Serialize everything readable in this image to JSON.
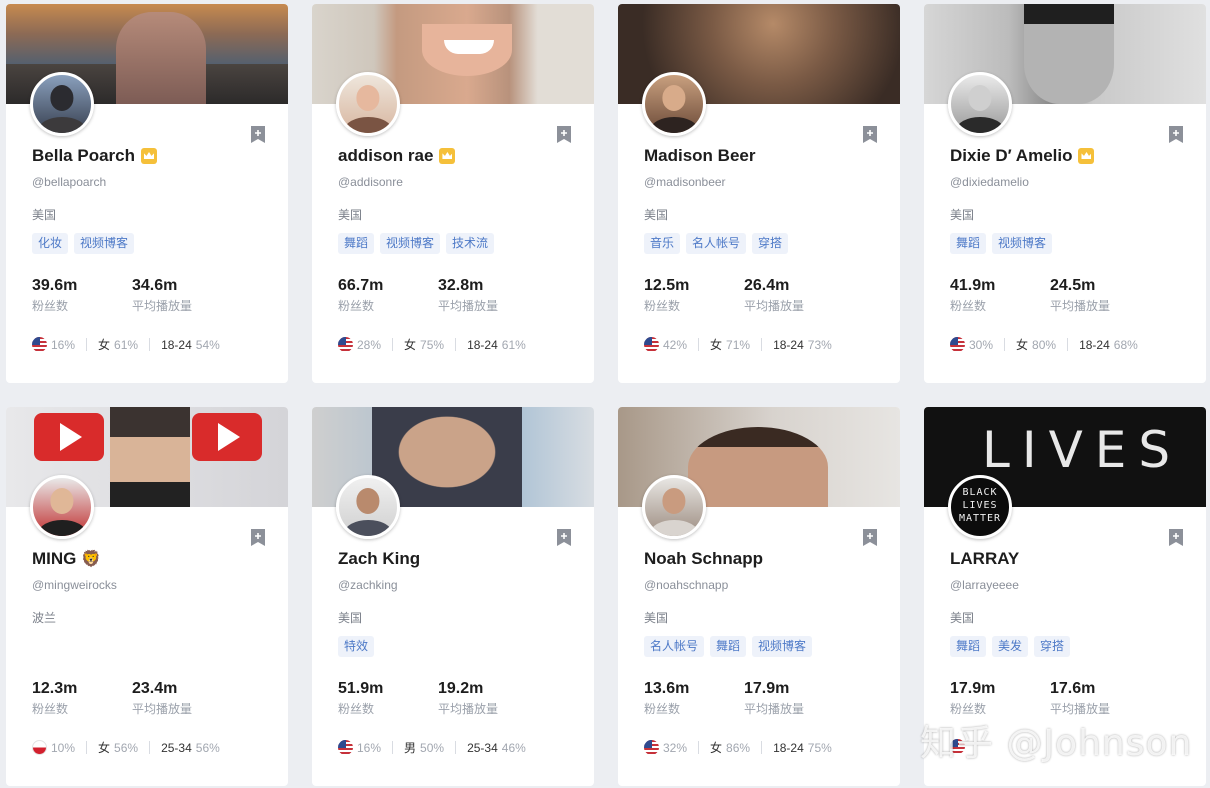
{
  "cards": [
    {
      "name": "Bella Poarch",
      "badge": "crown",
      "handle": "@bellapoarch",
      "country": "美国",
      "tags": [
        "化妆",
        "视频博客"
      ],
      "followers": "39.6m",
      "followers_label": "粉丝数",
      "avg_views": "34.6m",
      "avg_views_label": "平均播放量",
      "flag": "us-flag-icon",
      "country_pct": "16%",
      "gender": "女",
      "gender_pct": "61%",
      "age": "18-24",
      "age_pct": "54%"
    },
    {
      "name": "addison rae",
      "badge": "crown",
      "handle": "@addisonre",
      "country": "美国",
      "tags": [
        "舞蹈",
        "视频博客",
        "技术流"
      ],
      "followers": "66.7m",
      "followers_label": "粉丝数",
      "avg_views": "32.8m",
      "avg_views_label": "平均播放量",
      "flag": "us-flag-icon",
      "country_pct": "28%",
      "gender": "女",
      "gender_pct": "75%",
      "age": "18-24",
      "age_pct": "61%"
    },
    {
      "name": "Madison Beer",
      "badge": "",
      "handle": "@madisonbeer",
      "country": "美国",
      "tags": [
        "音乐",
        "名人帐号",
        "穿搭"
      ],
      "followers": "12.5m",
      "followers_label": "粉丝数",
      "avg_views": "26.4m",
      "avg_views_label": "平均播放量",
      "flag": "us-flag-icon",
      "country_pct": "42%",
      "gender": "女",
      "gender_pct": "71%",
      "age": "18-24",
      "age_pct": "73%"
    },
    {
      "name": "Dixie D′ Amelio",
      "badge": "crown",
      "handle": "@dixiedamelio",
      "country": "美国",
      "tags": [
        "舞蹈",
        "视频博客"
      ],
      "followers": "41.9m",
      "followers_label": "粉丝数",
      "avg_views": "24.5m",
      "avg_views_label": "平均播放量",
      "flag": "us-flag-icon",
      "country_pct": "30%",
      "gender": "女",
      "gender_pct": "80%",
      "age": "18-24",
      "age_pct": "68%"
    },
    {
      "name": "MING",
      "badge": "emoji",
      "emoji": "🦁",
      "handle": "@mingweirocks",
      "country": "波兰",
      "tags": [],
      "followers": "12.3m",
      "followers_label": "粉丝数",
      "avg_views": "23.4m",
      "avg_views_label": "平均播放量",
      "flag": "poland-flag-icon",
      "country_pct": "10%",
      "gender": "女",
      "gender_pct": "56%",
      "age": "25-34",
      "age_pct": "56%"
    },
    {
      "name": "Zach King",
      "badge": "",
      "handle": "@zachking",
      "country": "美国",
      "tags": [
        "特效"
      ],
      "followers": "51.9m",
      "followers_label": "粉丝数",
      "avg_views": "19.2m",
      "avg_views_label": "平均播放量",
      "flag": "us-flag-icon",
      "country_pct": "16%",
      "gender": "男",
      "gender_pct": "50%",
      "age": "25-34",
      "age_pct": "46%"
    },
    {
      "name": "Noah Schnapp",
      "badge": "",
      "handle": "@noahschnapp",
      "country": "美国",
      "tags": [
        "名人帐号",
        "舞蹈",
        "视频博客"
      ],
      "followers": "13.6m",
      "followers_label": "粉丝数",
      "avg_views": "17.9m",
      "avg_views_label": "平均播放量",
      "flag": "us-flag-icon",
      "country_pct": "32%",
      "gender": "女",
      "gender_pct": "86%",
      "age": "18-24",
      "age_pct": "75%"
    },
    {
      "name": "LARRAY",
      "badge": "",
      "handle": "@larrayeeee",
      "country": "美国",
      "tags": [
        "舞蹈",
        "美发",
        "穿搭"
      ],
      "followers": "17.9m",
      "followers_label": "粉丝数",
      "avg_views": "17.6m",
      "avg_views_label": "平均播放量",
      "flag": "us-flag-icon",
      "country_pct": "",
      "gender": "",
      "gender_pct": "",
      "age": "",
      "age_pct": "",
      "banner_text": "LIVES",
      "avatar_text": "BLACK LIVES MATTER"
    }
  ],
  "watermark": "知乎 @Johnson",
  "colors": {
    "tag_text": "#4d79c7",
    "tag_bg": "#eef2fa",
    "badge_gold": "#f5c03a",
    "bookmark": "#8c9099"
  }
}
